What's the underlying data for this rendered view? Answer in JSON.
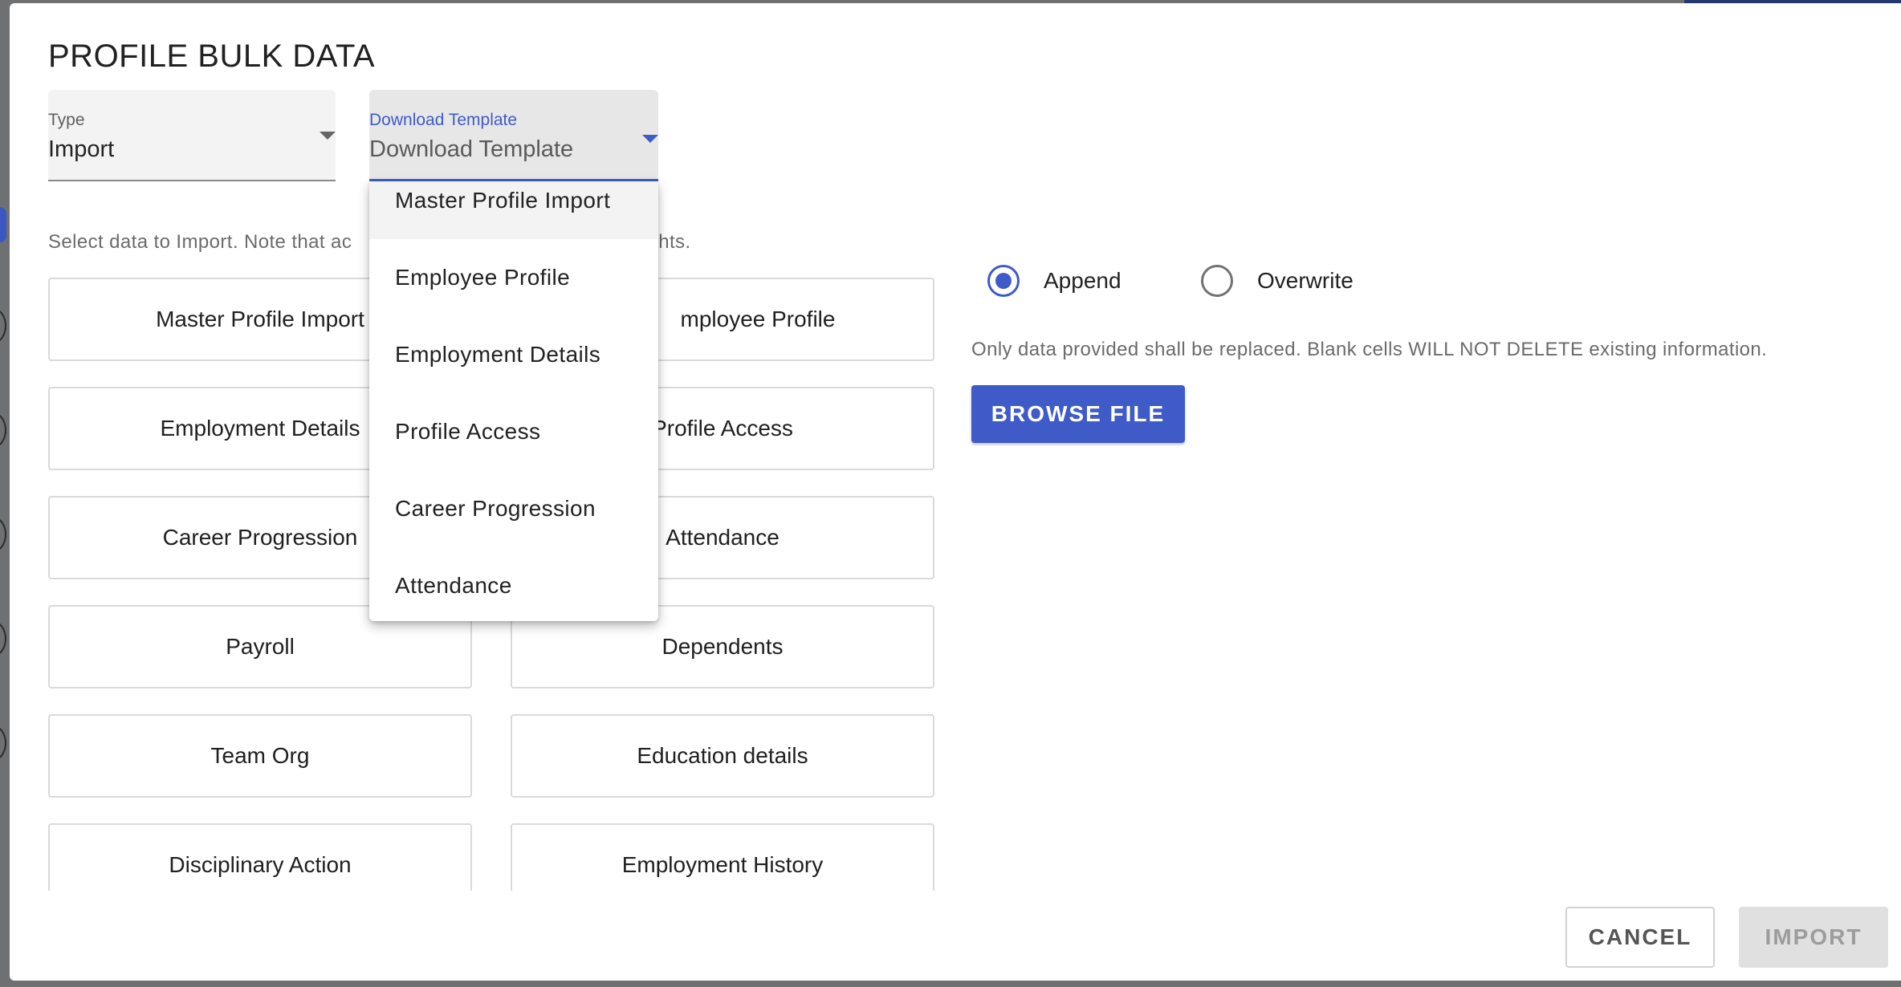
{
  "dialog": {
    "title": "PROFILE BULK DATA",
    "type_select": {
      "label": "Type",
      "value": "Import"
    },
    "template_select": {
      "label": "Download Template",
      "value": "Download Template"
    },
    "helper_left": "Select data to Import. Note that ac",
    "helper_right": "hts.",
    "tiles": [
      {
        "label": "Master Profile Import"
      },
      {
        "label": "mployee Profile"
      },
      {
        "label": "Employment Details"
      },
      {
        "label": "Profile Access"
      },
      {
        "label": "Career Progression"
      },
      {
        "label": "Attendance"
      },
      {
        "label": "Payroll"
      },
      {
        "label": "Dependents"
      },
      {
        "label": "Team Org"
      },
      {
        "label": "Education details"
      },
      {
        "label": "Disciplinary Action"
      },
      {
        "label": "Employment History"
      }
    ],
    "dropdown_options": [
      "Master Profile Import",
      "Employee Profile",
      "Employment Details",
      "Profile Access",
      "Career Progression",
      "Attendance"
    ],
    "mode": {
      "append_label": "Append",
      "overwrite_label": "Overwrite",
      "selected": "Append"
    },
    "note": "Only data provided shall be replaced. Blank cells WILL NOT DELETE existing information.",
    "browse_label": "BROWSE FILE",
    "cancel_label": "CANCEL",
    "import_label": "IMPORT"
  },
  "colors": {
    "accent": "#3f5bc7",
    "disabled": "#e0e0e0"
  }
}
